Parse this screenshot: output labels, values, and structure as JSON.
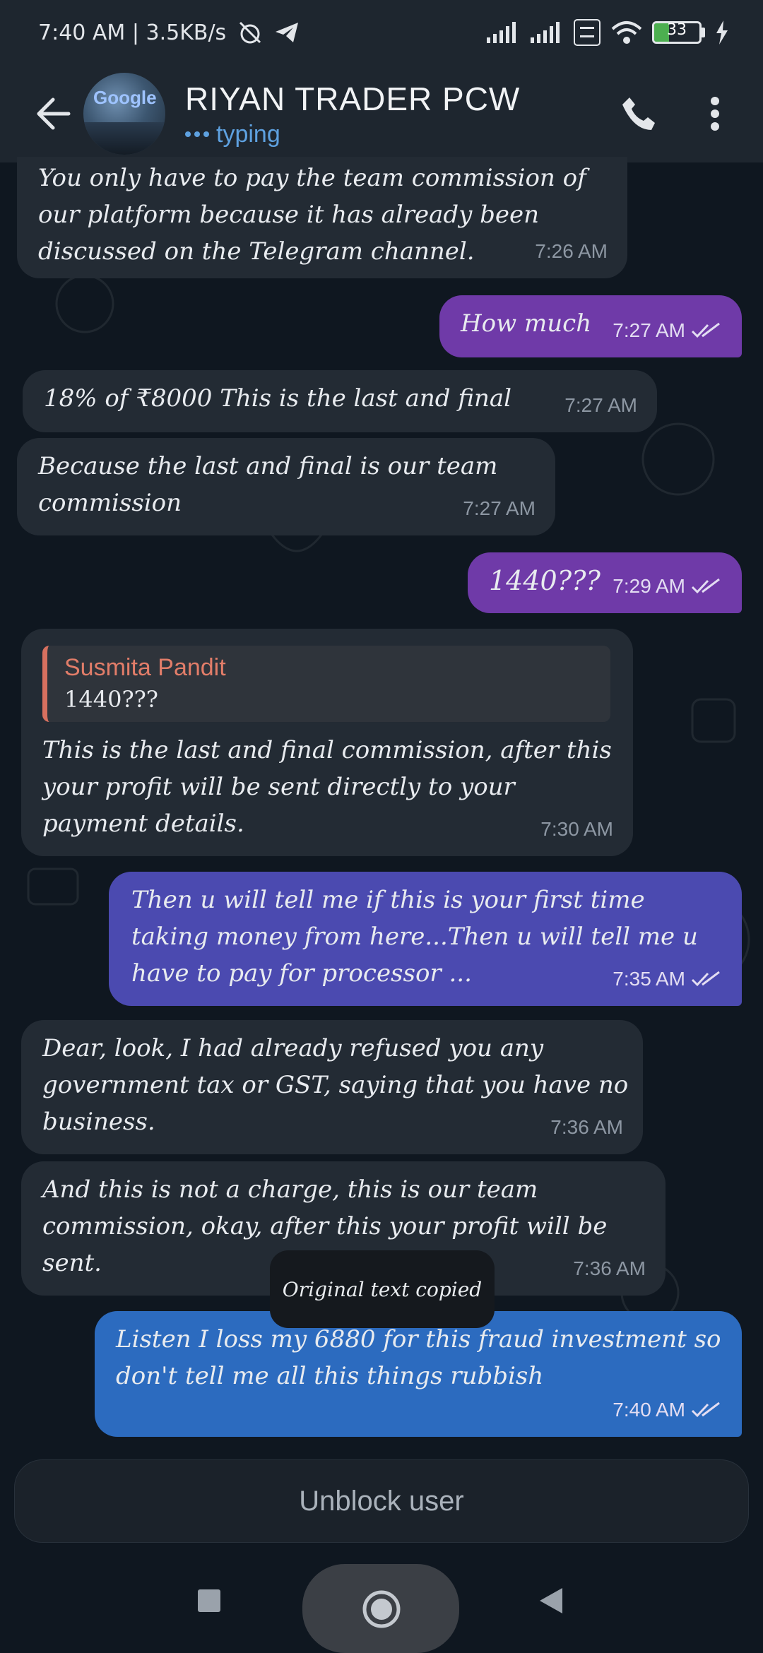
{
  "status_bar": {
    "left": "7:40 AM | 3.5KB/s",
    "battery": "33"
  },
  "header": {
    "title": "RIYAN TRADER PCW",
    "subtitle": "typing",
    "avatar_text": "Google"
  },
  "messages": [
    {
      "text": "You only have to pay the team commission of our platform because it has already been discussed on the Telegram channel.",
      "time": "7:26 AM"
    },
    {
      "text": "How much",
      "time": "7:27 AM"
    },
    {
      "text": "18% of ₹8000 This is the last and final",
      "time": "7:27 AM"
    },
    {
      "text": "Because the last and final is our team commission",
      "time": "7:27 AM"
    },
    {
      "text": "1440???",
      "time": "7:29 AM"
    },
    {
      "reply_name": "Susmita Pandit",
      "reply_text": "1440???",
      "text": "This is the last and final commission, after this your profit will be sent directly to your payment details.",
      "time": "7:30 AM"
    },
    {
      "text": "Then u will tell me if this is your first time taking money from here...Then u will tell me u have to pay for processor ...",
      "time": "7:35 AM"
    },
    {
      "text": "Dear, look, I had already refused you any government tax or GST, saying that you have no business.",
      "time": "7:36 AM"
    },
    {
      "text": "And this is not a charge, this is our team commission, okay, after this your profit will be sent.",
      "time": "7:36 AM"
    },
    {
      "text": "Listen I loss my 6880 for this fraud investment so don't tell me all this things rubbish",
      "time": "7:40 AM"
    }
  ],
  "toast": "Original text copied",
  "unblock_label": "Unblock user",
  "colors": {
    "background": "#0f1720",
    "header": "#1e262f",
    "incoming_bubble": "#232b34",
    "outgoing_purple": "#6f3aa8",
    "outgoing_indigo": "#4b4ab0",
    "outgoing_blue": "#2c6bbf",
    "accent": "#5ea1e0",
    "reply_name": "#e27d69"
  }
}
